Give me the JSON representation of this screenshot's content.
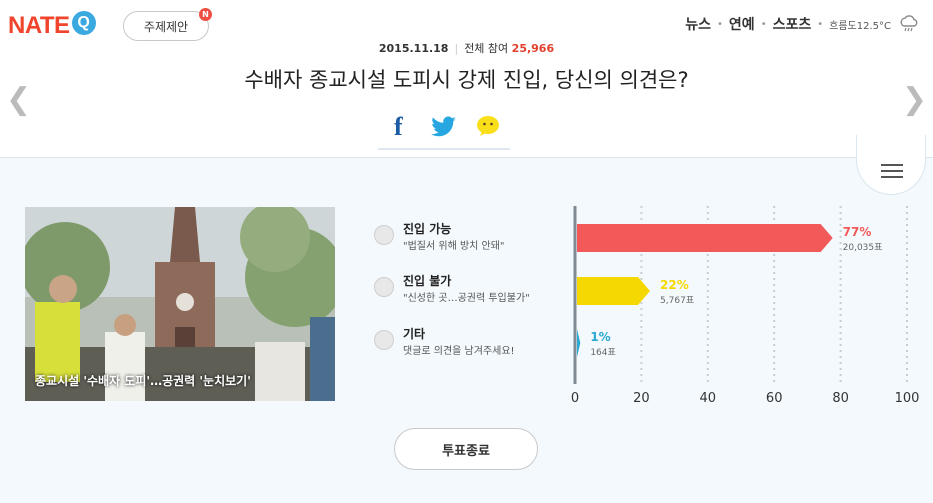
{
  "header": {
    "logo_text": "NATE",
    "logo_q": "Q",
    "suggest_label": "주제제안",
    "new_badge": "N",
    "nav": [
      "뉴스",
      "연예",
      "스포츠"
    ],
    "weather": "흐름도12.5°C"
  },
  "poll": {
    "date": "2015.11.18",
    "participants_label": "전체 참여",
    "participants": "25,966",
    "title": "수배자 종교시설 도피시 강제 진입, 당신의 의견은?",
    "photo_caption": "종교시설 '수배자 도피'…공권력 '눈치보기'",
    "options": [
      {
        "label": "진입 가능",
        "desc": "\"법질서 위해 방치 안돼\""
      },
      {
        "label": "진입 불가",
        "desc": "\"신성한 곳…공권력 투입불가\""
      },
      {
        "label": "기타",
        "desc": "댓글로 의견을 남겨주세요!"
      }
    ],
    "end_label": "투표종료"
  },
  "colors": {
    "brand": "#f0442d",
    "bar_yes": "#f25a5a",
    "bar_no": "#f5d800",
    "bar_other": "#2aa8d4"
  },
  "chart_data": {
    "type": "bar",
    "orientation": "horizontal",
    "categories": [
      "진입 가능",
      "진입 불가",
      "기타"
    ],
    "values": [
      77,
      22,
      1
    ],
    "percent_labels": [
      "77%",
      "22%",
      "1%"
    ],
    "count_labels": [
      "20,035표",
      "5,767표",
      "164표"
    ],
    "xlim": [
      0,
      100
    ],
    "x_ticks": [
      "0",
      "20",
      "40",
      "60",
      "80",
      "100"
    ],
    "grid": true
  }
}
